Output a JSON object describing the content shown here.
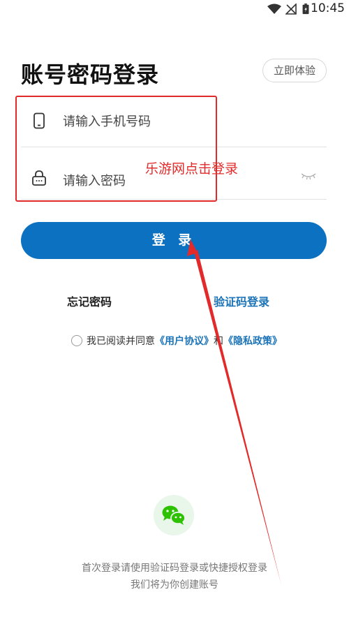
{
  "status_bar": {
    "time": "10:45"
  },
  "page": {
    "title": "账号密码登录",
    "try_label": "立即体验"
  },
  "form": {
    "phone_placeholder": "请输入手机号码",
    "password_placeholder": "请输入密码"
  },
  "annotation": {
    "text": "乐游网点击登录",
    "color": "#e32a2a"
  },
  "actions": {
    "login_label": "登 录",
    "forgot_label": "忘记密码",
    "code_login_label": "验证码登录"
  },
  "agreement": {
    "prefix": "我已阅读并同意",
    "user_agreement": "《用户协议》",
    "and": "和",
    "privacy_policy": "《隐私政策》"
  },
  "footer": {
    "line1": "首次登录请使用验证码登录或快捷授权登录",
    "line2": "我们将为你创建账号"
  },
  "colors": {
    "accent": "#0b71c0",
    "link": "#1c74b8",
    "wechat": "#2dc100"
  }
}
